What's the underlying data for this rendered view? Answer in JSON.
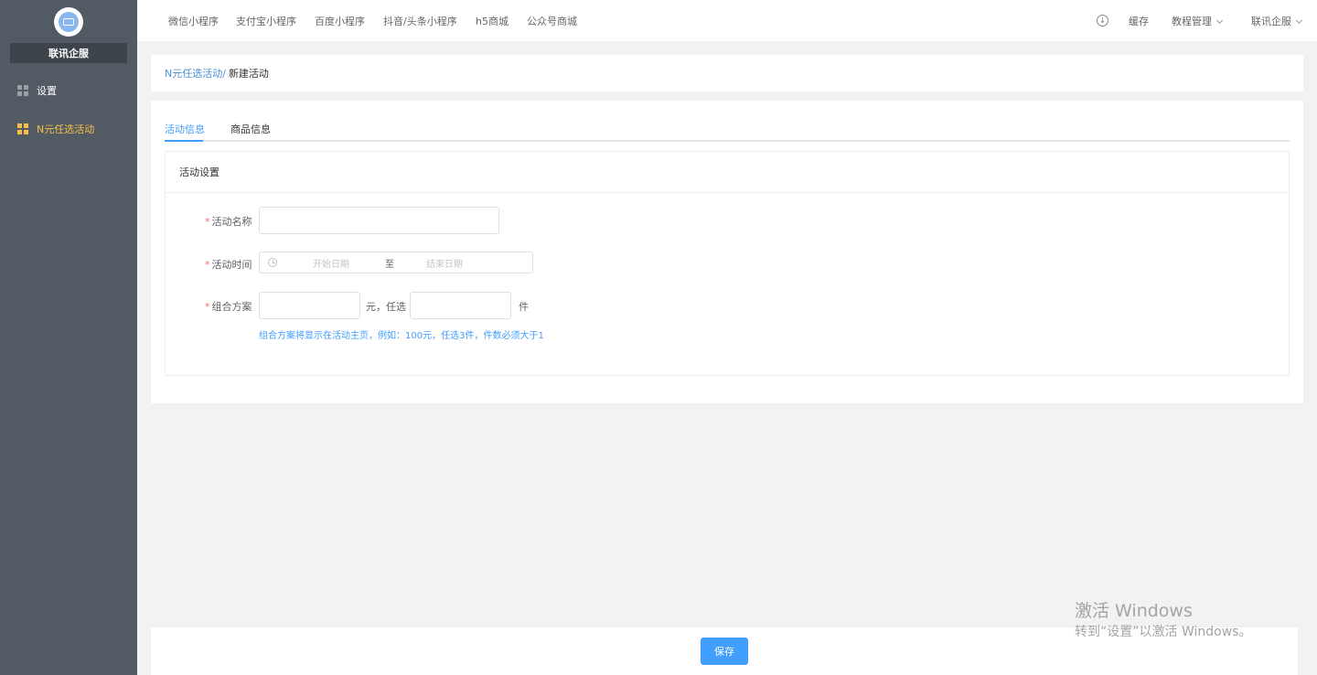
{
  "sidebar": {
    "brand": "联讯企服",
    "items": [
      {
        "label": "设置",
        "active": false
      },
      {
        "label": "N元任选活动",
        "active": true
      }
    ]
  },
  "topbar": {
    "links": [
      "微信小程序",
      "支付宝小程序",
      "百度小程序",
      "抖音/头条小程序",
      "h5商城",
      "公众号商城"
    ],
    "cache": "缓存",
    "tutorial": "教程管理",
    "user": "联讯企服"
  },
  "breadcrumb": {
    "parent": "N元任选活动/",
    "current": "新建活动"
  },
  "tabs": [
    "活动信息",
    "商品信息"
  ],
  "panel": {
    "title": "活动设置",
    "name_label": "活动名称",
    "time_label": "活动时间",
    "start_placeholder": "开始日期",
    "range_sep": "至",
    "end_placeholder": "结束日期",
    "combo_label": "组合方案",
    "yuan_text": "元，任选",
    "piece_text": "件",
    "hint": "组合方案将显示在活动主页，例如：100元，任选3件，件数必须大于1"
  },
  "footer": {
    "save": "保存"
  },
  "watermark": {
    "line1": "激活 Windows",
    "line2": "转到“设置”以激活 Windows。"
  },
  "colors": {
    "sidebar_bg": "#525a63",
    "active_accent": "#f7c046",
    "primary": "#409eff"
  }
}
